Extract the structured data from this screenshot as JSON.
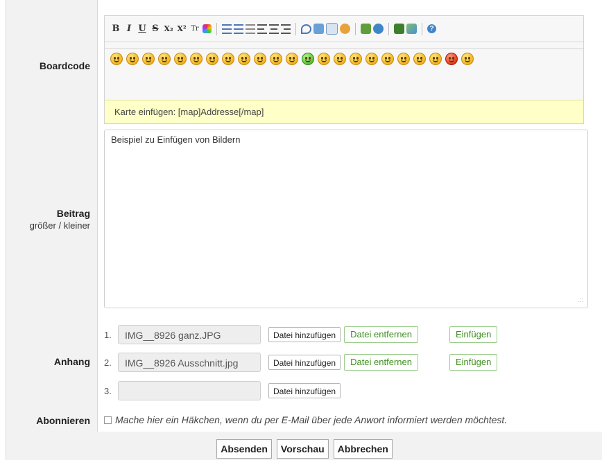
{
  "boardcode": {
    "label": "Boardcode",
    "toolbar": [
      {
        "name": "bold-button",
        "glyph": "B",
        "cls": "b"
      },
      {
        "name": "italic-button",
        "glyph": "I",
        "cls": "i"
      },
      {
        "name": "underline-button",
        "glyph": "U",
        "cls": "u"
      },
      {
        "name": "strikethrough-button",
        "glyph": "S",
        "cls": "s"
      },
      {
        "name": "subscript-button",
        "glyph": "X₂",
        "cls": "b"
      },
      {
        "name": "superscript-button",
        "glyph": "X²",
        "cls": "b"
      },
      {
        "name": "font-size-button",
        "glyph": "Tr",
        "cls": ""
      }
    ],
    "smiley_count": 23,
    "hint": "Karte einfügen: [map]Addresse[/map]"
  },
  "beitrag": {
    "label": "Beitrag",
    "size_controls": "größer / kleiner",
    "content": "Beispiel zu Einfügen von Bildern"
  },
  "anhang": {
    "label": "Anhang",
    "items": [
      {
        "num": "1.",
        "file": "IMG__8926 ganz.JPG",
        "add": "Datei hinzufügen",
        "remove": "Datei entfernen",
        "insert": "Einfügen"
      },
      {
        "num": "2.",
        "file": "IMG__8926 Ausschnitt.jpg",
        "add": "Datei hinzufügen",
        "remove": "Datei entfernen",
        "insert": "Einfügen"
      },
      {
        "num": "3.",
        "file": "",
        "add": "Datei hinzufügen"
      }
    ]
  },
  "abonnieren": {
    "label": "Abonnieren",
    "checkbox_text": "Mache hier ein Häkchen, wenn du per E-Mail über jede Anwort informiert werden möchtest."
  },
  "footer": {
    "submit": "Absenden",
    "preview": "Vorschau",
    "cancel": "Abbrechen"
  },
  "colors": {
    "label_bg": "#f2f2f2",
    "hint_bg": "#ffffc8",
    "green_button_text": "#3d8f1d"
  }
}
